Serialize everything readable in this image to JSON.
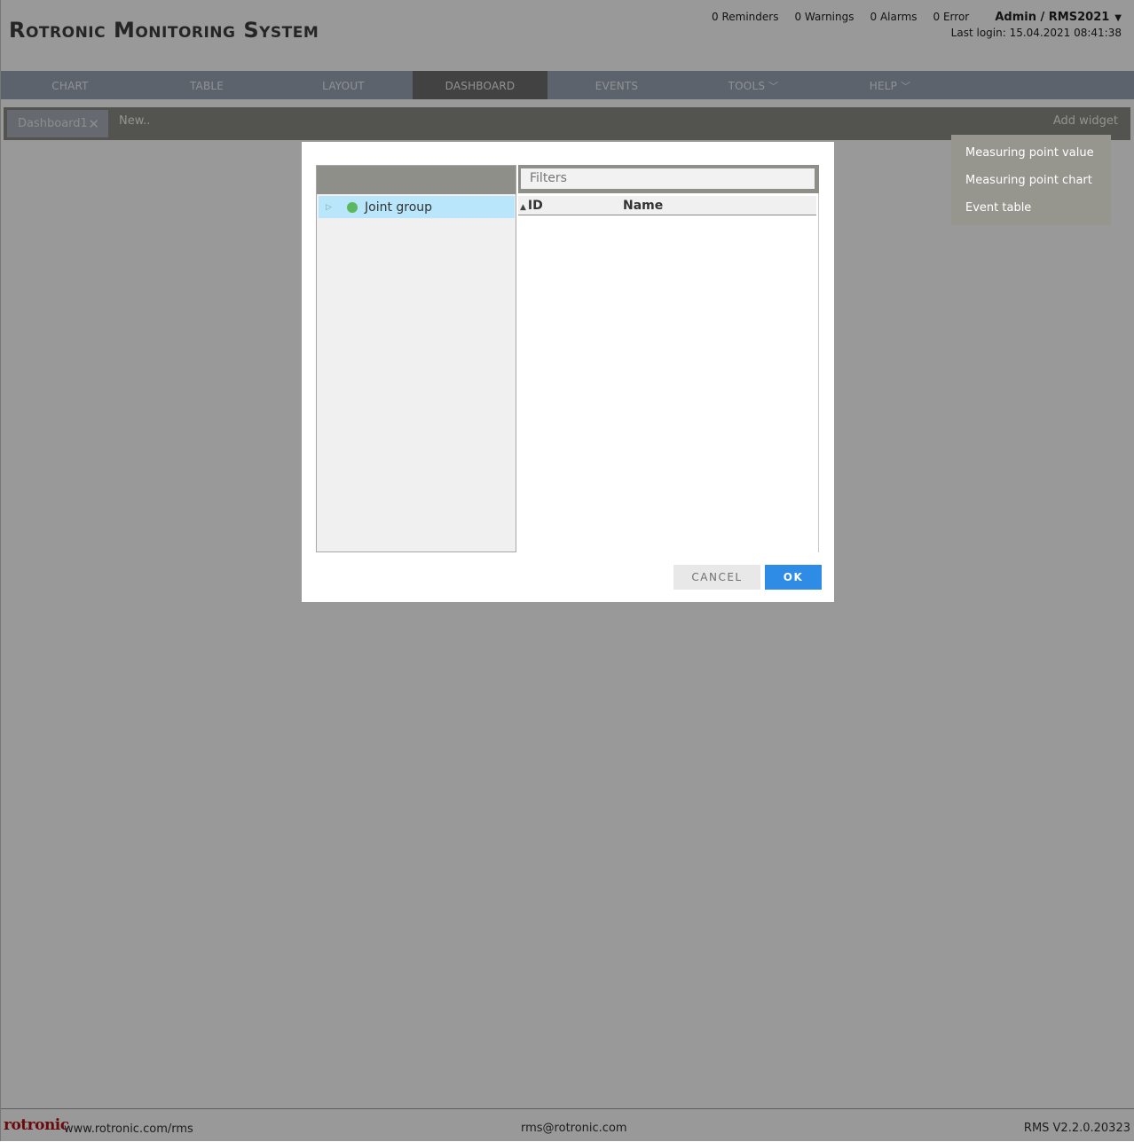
{
  "header": {
    "title": "Rotronic Monitoring System",
    "status": {
      "reminders": "0 Reminders",
      "warnings": "0 Warnings",
      "alarms": "0 Alarms",
      "errors": "0 Error"
    },
    "user": "Admin / RMS2021",
    "last_login": "Last login: 15.04.2021 08:41:38"
  },
  "nav": {
    "items": [
      {
        "label": "CHART"
      },
      {
        "label": "TABLE"
      },
      {
        "label": "LAYOUT"
      },
      {
        "label": "DASHBOARD",
        "active": true
      },
      {
        "label": "EVENTS"
      },
      {
        "label": "TOOLS"
      },
      {
        "label": "HELP"
      }
    ]
  },
  "tabs": {
    "active_tab": "Dashboard1",
    "new_label": "New..",
    "add_widget": "Add widget"
  },
  "widget_menu": {
    "items": [
      "Measuring point value",
      "Measuring point chart",
      "Event table"
    ]
  },
  "dialog": {
    "tree": {
      "items": [
        "Joint group"
      ]
    },
    "filter_placeholder": "Filters",
    "columns": {
      "id": "ID",
      "name": "Name"
    },
    "cancel": "CANCEL",
    "ok": "OK"
  },
  "footer": {
    "logo": "rotronic",
    "url": "www.rotronic.com/rms",
    "email": "rms@rotronic.com",
    "version": "RMS V2.2.0.20323"
  },
  "colors": {
    "nav_bg": "#9aa6b6",
    "ok_button": "#2e8be6",
    "selected_row": "#b9e6fb",
    "status_dot": "#5cb85c",
    "logo": "#b01418"
  }
}
